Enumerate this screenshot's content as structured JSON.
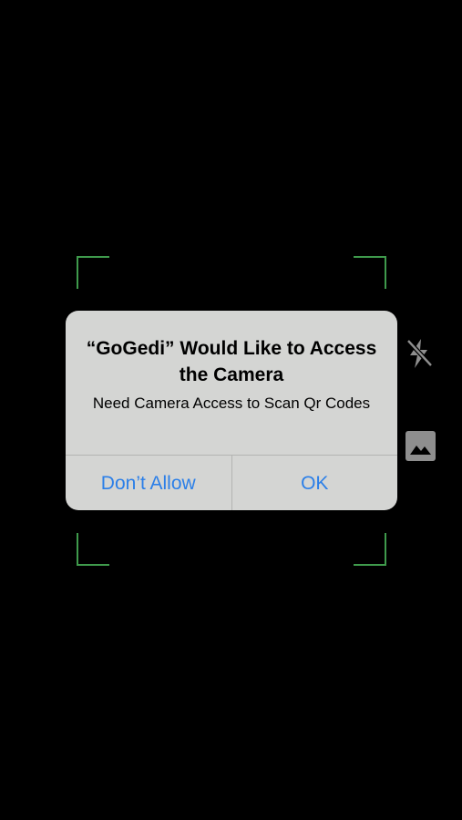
{
  "scanner": {
    "frame_color": "#3f9a4c"
  },
  "side_controls": {
    "flash": {
      "icon": "flash-off-icon"
    },
    "gallery": {
      "icon": "image-gallery-icon"
    }
  },
  "alert": {
    "title": "“GoGedi” Would Like to Access the Camera",
    "message": "Need Camera Access to Scan Qr Codes",
    "buttons": {
      "deny": "Don’t Allow",
      "allow": "OK"
    },
    "accent_color": "#2b7fe8",
    "background_color": "#d4d5d3"
  }
}
